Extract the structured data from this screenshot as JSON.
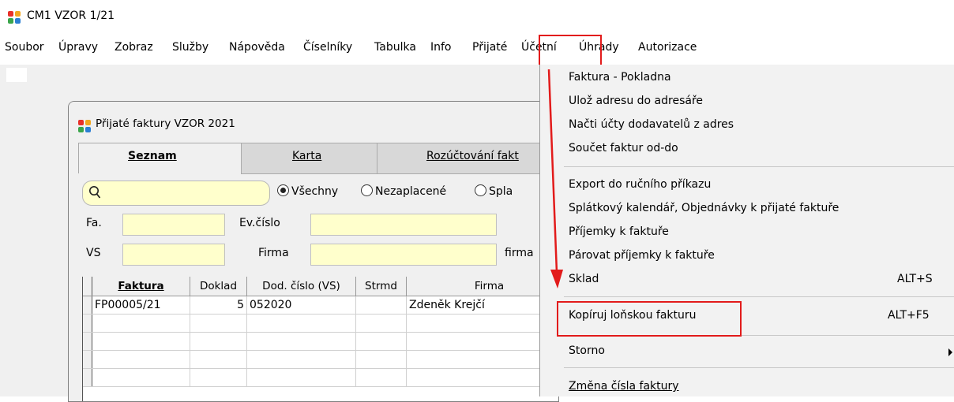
{
  "app": {
    "title": "CM1 VZOR 1/21"
  },
  "menubar": [
    "Soubor",
    "Úpravy",
    "Zobraz",
    "Služby",
    "Nápověda",
    "Číselníky",
    "Tabulka",
    "Info",
    "Přijaté",
    "Účetní",
    "Úhrady",
    "Autorizace"
  ],
  "child_window": {
    "title": "Přijaté faktury VZOR  2021",
    "tabs": [
      "Seznam",
      "Karta",
      "Rozúčtování fakt"
    ],
    "filters": [
      "Všechny",
      "Nezaplacené",
      "Spla"
    ],
    "filter_selected": "Všechny",
    "fields": {
      "fa": "Fa.",
      "ev": "Ev.číslo",
      "vs": "VS",
      "firma": "Firma",
      "firma2": "firma"
    },
    "grid": {
      "columns": [
        "Faktura",
        "Doklad",
        "Dod. číslo (VS)",
        "Strmd",
        "Firma"
      ],
      "rows": [
        [
          "FP00005/21",
          "5",
          "052020",
          "",
          "Zdeněk Krejčí"
        ]
      ]
    }
  },
  "dropdown": {
    "items": [
      {
        "label": "Faktura - Pokladna",
        "shortcut": ""
      },
      {
        "label": "Ulož adresu do adresáře",
        "shortcut": ""
      },
      {
        "label": "Načti účty dodavatelů z adres",
        "shortcut": ""
      },
      {
        "label": "Součet faktur od-do",
        "shortcut": ""
      },
      {
        "label": "Export do ručního příkazu",
        "shortcut": ""
      },
      {
        "label": "Splátkový kalendář, Objednávky k přijaté faktuře",
        "shortcut": ""
      },
      {
        "label": "Příjemky k faktuře",
        "shortcut": ""
      },
      {
        "label": "Párovat příjemky k faktuře",
        "shortcut": ""
      },
      {
        "label": "Sklad",
        "shortcut": "ALT+S"
      },
      {
        "label": "Kopíruj loňskou fakturu",
        "shortcut": "ALT+F5"
      },
      {
        "label": "Storno",
        "shortcut": ""
      },
      {
        "label": "Změna čísla faktury",
        "shortcut": ""
      }
    ]
  },
  "colors": {
    "highlight_red": "#e21b1b",
    "input_yellow": "#ffffcc"
  },
  "icons": [
    "app-logo-icon",
    "search-icon",
    "submenu-arrow-icon"
  ]
}
